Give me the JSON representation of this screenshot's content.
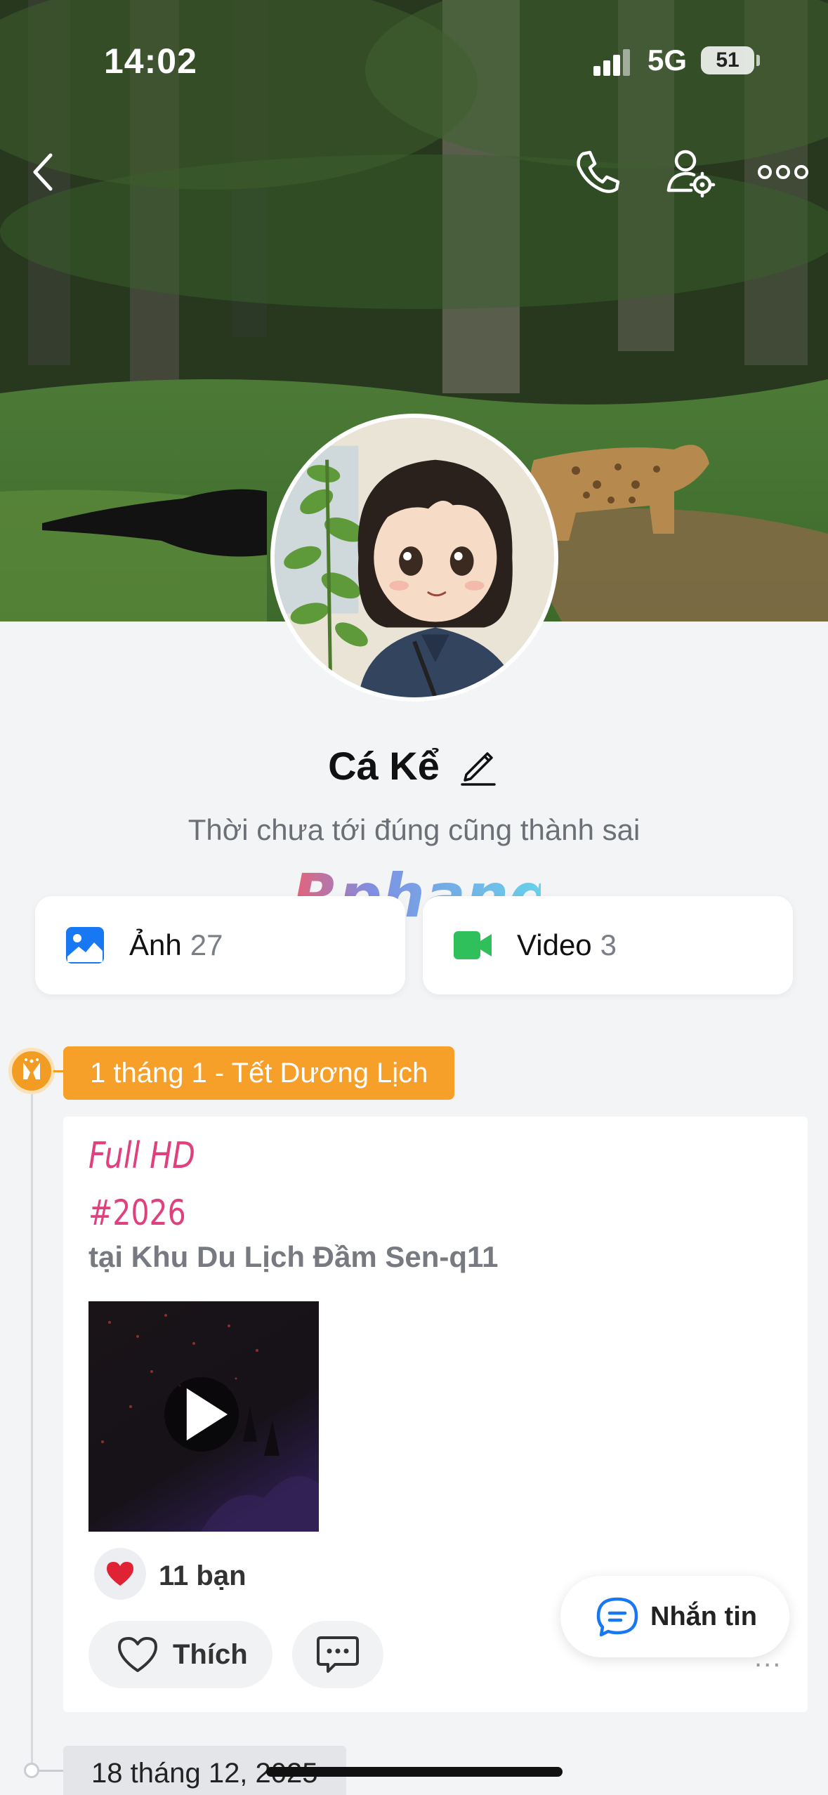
{
  "status_bar": {
    "time": "14:02",
    "network": "5G",
    "battery": "51"
  },
  "nav": {
    "back_icon": "chevron-left-icon",
    "call_icon": "phone-icon",
    "settings_icon": "user-gear-icon",
    "more_icon": "more-horizontal-icon"
  },
  "profile": {
    "name": "Cá Kể",
    "bio": "Thời chưa tới đúng cũng thành sai",
    "watermark": "Rphang"
  },
  "media": {
    "photos": {
      "label": "Ảnh",
      "count": "27",
      "icon": "image-icon",
      "color": "#1877f2"
    },
    "videos": {
      "label": "Video",
      "count": "3",
      "icon": "video-camera-icon",
      "color": "#2fbf5b"
    }
  },
  "timeline": {
    "event": {
      "label": "1 tháng 1 - Tết Dương Lịch",
      "icon": "celebration-icon",
      "color": "#f7a029"
    },
    "post": {
      "line1": "Full HD",
      "line2": "#2026",
      "location": "tại Khu Du Lịch Đầm Sen-q11",
      "reaction_count": "11 bạn",
      "like_label": "Thích",
      "more": "..."
    },
    "next_date": "18 tháng 12, 2025"
  },
  "fab": {
    "label": "Nhắn tin"
  },
  "colors": {
    "accent_pink": "#e0407e",
    "background": "#f3f4f6"
  }
}
